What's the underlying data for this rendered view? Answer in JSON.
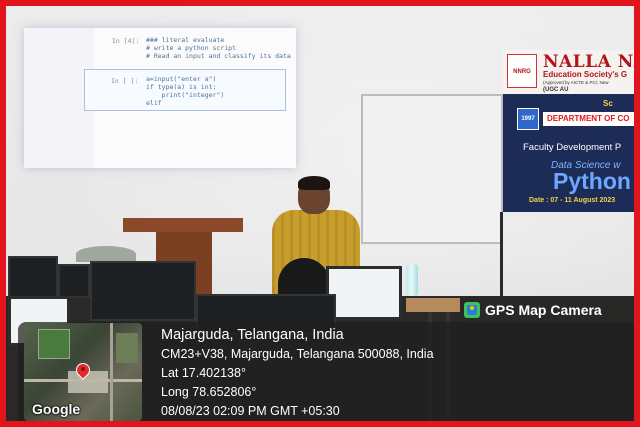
{
  "projection": {
    "prompt_1": "In [4]:",
    "code_1": "### literal evaluate\n# write a python script\n# Read an input and classify its data",
    "prompt_2": "In [ ]:",
    "code_2": "a=input(\"enter a\")\nif type(a) is int:\n    print(\"integer\")\nelif"
  },
  "banner": {
    "title": "NALLA NA",
    "subtitle": "Education Society's G",
    "small": "(Approved by AICTE & PCI, New",
    "small2": "(UGC AU",
    "logo": "NNRG",
    "sc": "Sc",
    "dept": "DEPARTMENT OF CO",
    "badge": "1997",
    "fdp": "Faculty Development P",
    "ds": "Data Science w",
    "python": "Python",
    "date": "Date : 07 - 11 August 2023"
  },
  "gps": {
    "app_name": "GPS Map Camera",
    "location": "Majarguda, Telangana, India",
    "address": "CM23+V38, Majarguda, Telangana 500088, India",
    "lat": "Lat 17.402138°",
    "long": "Long 78.652806°",
    "datetime": "08/08/23 02:09 PM GMT +05:30",
    "map_brand": "Google"
  }
}
